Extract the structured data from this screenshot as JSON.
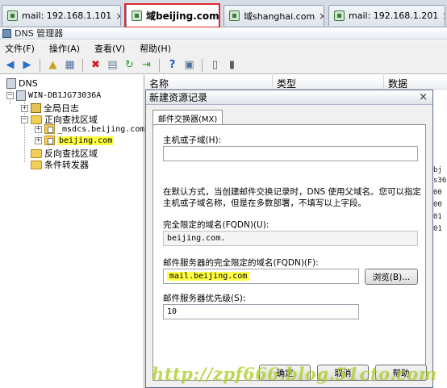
{
  "browser_tabs": [
    {
      "label": "mail: 192.168.1.101",
      "close": "×"
    },
    {
      "label": "域beijing.com",
      "close": "×"
    },
    {
      "label": "域shanghai.com",
      "close": "×"
    },
    {
      "label": "mail: 192.168.1.201",
      "close": "×"
    }
  ],
  "app": {
    "title": "DNS 管理器"
  },
  "menu": [
    "文件(F)",
    "操作(A)",
    "查看(V)",
    "帮助(H)"
  ],
  "tree": {
    "root": "DNS",
    "server": "WIN-DB1JG73036A",
    "global_logs": "全局日志",
    "forward_zones": "正向查找区域",
    "msdcs_zone": "_msdcs.beijing.com",
    "beijing_zone": "beijing.com",
    "reverse_zones": "反向查找区域",
    "conditional_forwarders": "条件转发器"
  },
  "list": {
    "columns": [
      "名称",
      "类型",
      "数据"
    ],
    "right_fragments": [
      "bj",
      "s36",
      "00",
      "00",
      "01",
      "01"
    ]
  },
  "dialog": {
    "title": "新建资源记录",
    "close": "×",
    "tab": "邮件交换器(MX)",
    "host_label": "主机或子域(H):",
    "host_value": "",
    "description": "在默认方式，当创建邮件交换记录时，DNS 使用父域名。您可以指定主机或子域名称，但是在多数部署，不填写以上字段。",
    "fqdn_label": "完全限定的域名(FQDN)(U):",
    "fqdn_value": "beijing.com.",
    "mail_server_label": "邮件服务器的完全限定的域名(FQDN)(F):",
    "mail_server_value": "mail.beijing.com",
    "browse_button": "浏览(B)...",
    "priority_label": "邮件服务器优先级(S):",
    "priority_value": "10",
    "ok_button": "确定",
    "cancel_button": "取消",
    "help_button": "帮助"
  },
  "watermark": "http://zpf666.blog.51cto.com"
}
